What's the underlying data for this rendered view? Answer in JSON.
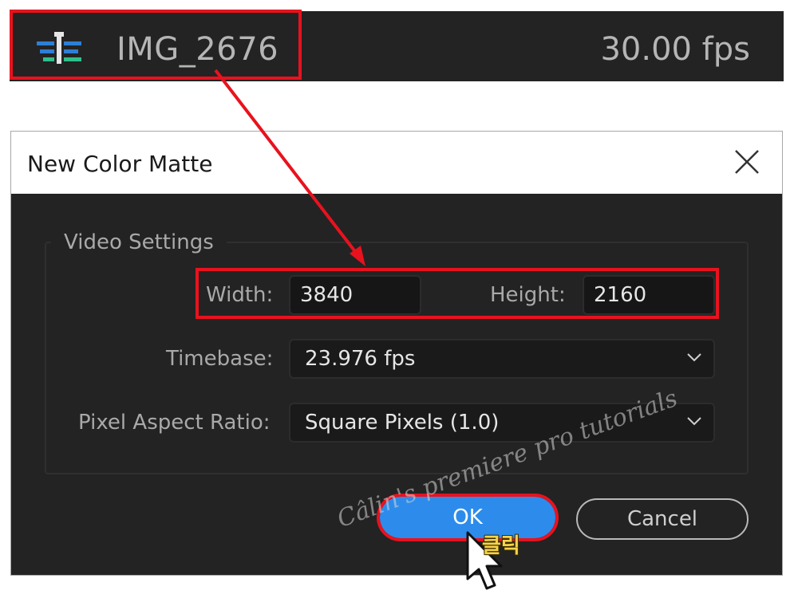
{
  "sequence": {
    "name": "IMG_2676",
    "fps": "30.00 fps",
    "icon": "sequence-icon"
  },
  "dialog": {
    "title": "New Color Matte",
    "close_icon": "close-icon",
    "group_title": "Video Settings",
    "width_label": "Width:",
    "width_value": "3840",
    "height_label": "Height:",
    "height_value": "2160",
    "timebase_label": "Timebase:",
    "timebase_value": "23.976 fps",
    "par_label": "Pixel Aspect Ratio:",
    "par_value": "Square Pixels (1.0)",
    "ok_label": "OK",
    "cancel_label": "Cancel"
  },
  "annotations": {
    "watermark": "Câlin's premiere pro tutorials",
    "click_text": "클릭",
    "highlight_color": "#e8121e"
  },
  "colors": {
    "panel_bg": "#232323",
    "accent_blue": "#2d8ceb",
    "text_gray": "#a9a9a9"
  }
}
